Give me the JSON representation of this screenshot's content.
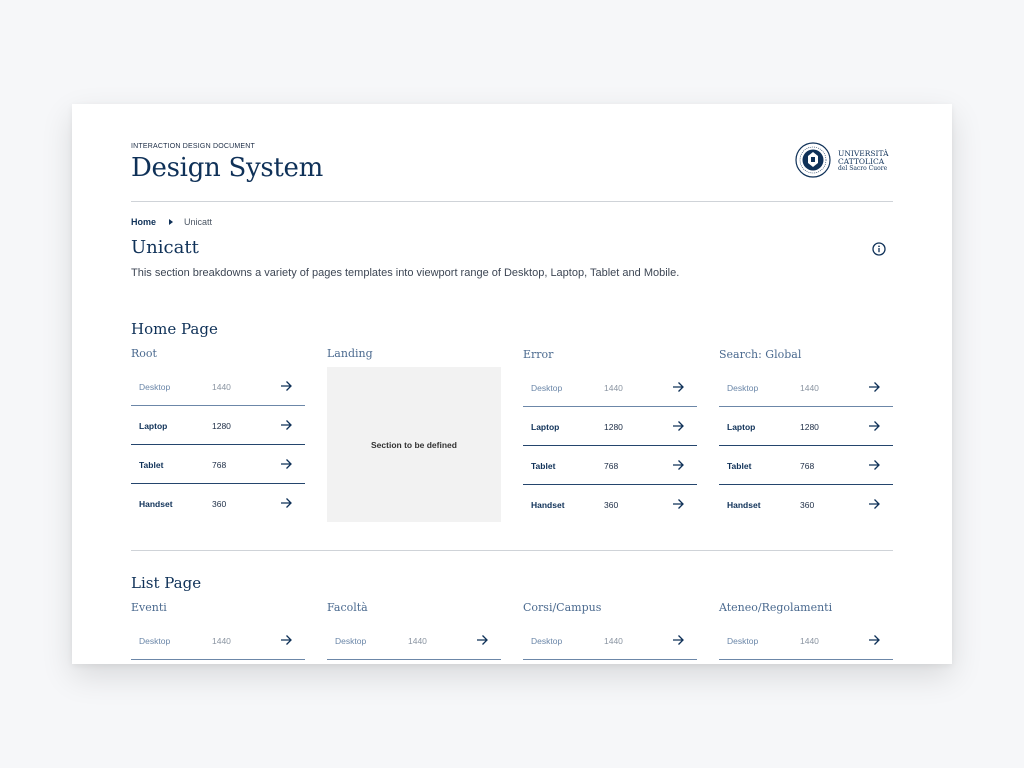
{
  "header": {
    "eyebrow": "INTERACTION DESIGN DOCUMENT",
    "title": "Design System",
    "logo": {
      "line1": "UNIVERSITÀ",
      "line2": "CATTOLICA",
      "line3": "del Sacro Cuore"
    }
  },
  "breadcrumb": {
    "home": "Home",
    "current": "Unicatt"
  },
  "page": {
    "title": "Unicatt",
    "description": "This section breakdowns a variety of pages templates into viewport range of Desktop, Laptop, Tablet and Mobile."
  },
  "sections": [
    {
      "title": "Home Page",
      "columns": [
        {
          "title": "Root",
          "rows": [
            {
              "label": "Desktop",
              "value": "1440"
            },
            {
              "label": "Laptop",
              "value": "1280"
            },
            {
              "label": "Tablet",
              "value": "768"
            },
            {
              "label": "Handset",
              "value": "360"
            }
          ]
        },
        {
          "title": "Landing",
          "placeholder": "Section to be defined"
        },
        {
          "title": "Error",
          "rows": [
            {
              "label": "Desktop",
              "value": "1440"
            },
            {
              "label": "Laptop",
              "value": "1280"
            },
            {
              "label": "Tablet",
              "value": "768"
            },
            {
              "label": "Handset",
              "value": "360"
            }
          ]
        },
        {
          "title": "Search: Global",
          "rows": [
            {
              "label": "Desktop",
              "value": "1440"
            },
            {
              "label": "Laptop",
              "value": "1280"
            },
            {
              "label": "Tablet",
              "value": "768"
            },
            {
              "label": "Handset",
              "value": "360"
            }
          ]
        }
      ]
    },
    {
      "title": "List Page",
      "columns": [
        {
          "title": "Eventi",
          "rows": [
            {
              "label": "Desktop",
              "value": "1440"
            }
          ]
        },
        {
          "title": "Facoltà",
          "rows": [
            {
              "label": "Desktop",
              "value": "1440"
            }
          ]
        },
        {
          "title": "Corsi/Campus",
          "rows": [
            {
              "label": "Desktop",
              "value": "1440"
            }
          ]
        },
        {
          "title": "Ateneo/Regolamenti",
          "rows": [
            {
              "label": "Desktop",
              "value": "1440"
            }
          ]
        }
      ]
    }
  ],
  "icons": {
    "info": "info-circle-icon",
    "arrow": "arrow-right-icon",
    "breadcrumb_separator": "caret-right-icon",
    "logo_seal": "university-seal-icon"
  },
  "colors": {
    "primary": "#0f3158",
    "muted_text": "#6a86a8",
    "divider": "#cfd3d8",
    "placeholder_bg": "#f2f2f2"
  }
}
